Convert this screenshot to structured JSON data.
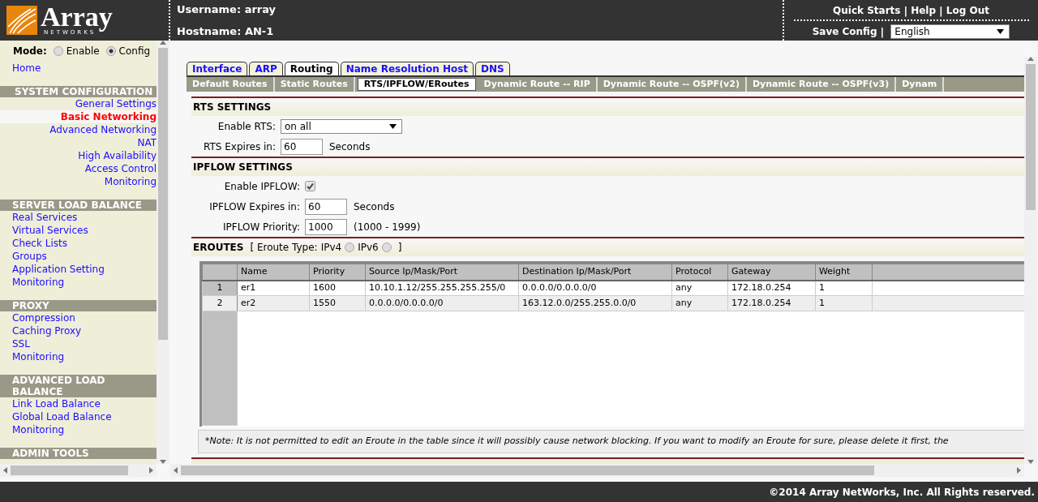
{
  "header": {
    "logo": {
      "wordmark": "Array",
      "tagline": "NETWORKS"
    },
    "username": "Username: array",
    "hostname": "Hostname: AN-1",
    "links": [
      "Quick Starts",
      "Help",
      "Log Out"
    ],
    "separator": "|",
    "save_config": "Save Config",
    "save_separator": "|",
    "language": "English"
  },
  "sidebar": {
    "mode_label": "Mode:",
    "modes": [
      {
        "label": "Enable",
        "selected": false
      },
      {
        "label": "Config",
        "selected": true
      }
    ],
    "home": "Home",
    "sections": [
      {
        "title": "SYSTEM CONFIGURATION",
        "kind": "right",
        "items": [
          {
            "label": "General Settings",
            "selected": false
          },
          {
            "label": "Basic Networking",
            "selected": true
          },
          {
            "label": "Advanced Networking",
            "selected": false
          },
          {
            "label": "NAT",
            "selected": false
          },
          {
            "label": "High Availability",
            "selected": false
          },
          {
            "label": "Access Control",
            "selected": false
          },
          {
            "label": "Monitoring",
            "selected": false
          }
        ]
      },
      {
        "title": "SERVER LOAD BALANCE",
        "kind": "left",
        "items": [
          {
            "label": "Real Services",
            "selected": false
          },
          {
            "label": "Virtual Services",
            "selected": false
          },
          {
            "label": "Check Lists",
            "selected": false
          },
          {
            "label": "Groups",
            "selected": false
          },
          {
            "label": "Application Setting",
            "selected": false
          },
          {
            "label": "Monitoring",
            "selected": false
          }
        ]
      },
      {
        "title": "PROXY",
        "kind": "left",
        "items": [
          {
            "label": "Compression",
            "selected": false
          },
          {
            "label": "Caching Proxy",
            "selected": false
          },
          {
            "label": "SSL",
            "selected": false
          },
          {
            "label": "Monitoring",
            "selected": false
          }
        ]
      },
      {
        "title": "ADVANCED LOAD BALANCE",
        "kind": "left",
        "items": [
          {
            "label": "Link Load Balance",
            "selected": false
          },
          {
            "label": "Global Load Balance",
            "selected": false
          },
          {
            "label": "Monitoring",
            "selected": false
          }
        ]
      },
      {
        "title": "ADMIN TOOLS",
        "kind": "left"
      }
    ]
  },
  "tabs": [
    {
      "label": "Interface",
      "selected": false
    },
    {
      "label": "ARP",
      "selected": false
    },
    {
      "label": "Routing",
      "selected": true
    },
    {
      "label": "Name Resolution Host",
      "selected": false
    },
    {
      "label": "DNS",
      "selected": false
    }
  ],
  "subtabs": [
    {
      "label": "Default Routes",
      "selected": false
    },
    {
      "label": "Static Routes",
      "selected": false
    },
    {
      "label": "RTS/IPFLOW/ERoutes",
      "selected": true
    },
    {
      "label": "Dynamic Route -- RIP",
      "selected": false
    },
    {
      "label": "Dynamic Route -- OSPF(v2)",
      "selected": false
    },
    {
      "label": "Dynamic Route -- OSPF(v3)",
      "selected": false
    },
    {
      "label": "Dynam",
      "selected": false
    }
  ],
  "rts": {
    "title": "RTS SETTINGS",
    "fields": [
      {
        "kind": "select",
        "label": "Enable RTS:",
        "value": "on all"
      },
      {
        "kind": "text",
        "label": "RTS Expires in:",
        "value": "60",
        "suffix": "Seconds"
      }
    ]
  },
  "ipflow": {
    "title": "IPFLOW SETTINGS",
    "fields": [
      {
        "kind": "checkbox",
        "label": "Enable IPFLOW:",
        "checked": true
      },
      {
        "kind": "text",
        "label": "IPFLOW Expires in:",
        "value": "60",
        "suffix": "Seconds"
      },
      {
        "kind": "text",
        "label": "IPFLOW Priority:",
        "value": "1000",
        "suffix": "(1000 - 1999)"
      }
    ]
  },
  "eroutes": {
    "title": "EROUTES",
    "type_open": "[ Eroute Type:",
    "types": [
      {
        "label": "IPv4",
        "selected": false
      },
      {
        "label": "IPv6",
        "selected": false
      }
    ],
    "type_close": "]",
    "columns": [
      "Name",
      "Priority",
      "Source Ip/Mask/Port",
      "Destination Ip/Mask/Port",
      "Protocol",
      "Gateway",
      "Weight"
    ],
    "rows": [
      {
        "number": "1",
        "cells": [
          "er1",
          "1600",
          "10.10.1.12/255.255.255.255/0",
          "0.0.0.0/0.0.0.0/0",
          "any",
          "172.18.0.254",
          "1"
        ]
      },
      {
        "number": "2",
        "cells": [
          "er2",
          "1550",
          "0.0.0.0/0.0.0.0/0",
          "163.12.0.0/255.255.0.0/0",
          "any",
          "172.18.0.254",
          "1"
        ]
      }
    ],
    "note": "*Note: It is not permitted to edit an Eroute in the table since it will possibly cause network blocking. If you want to modify an Eroute for sure, please delete it first, the"
  },
  "footer": "©2014 Array NetWorks, Inc. All Rights reserved."
}
